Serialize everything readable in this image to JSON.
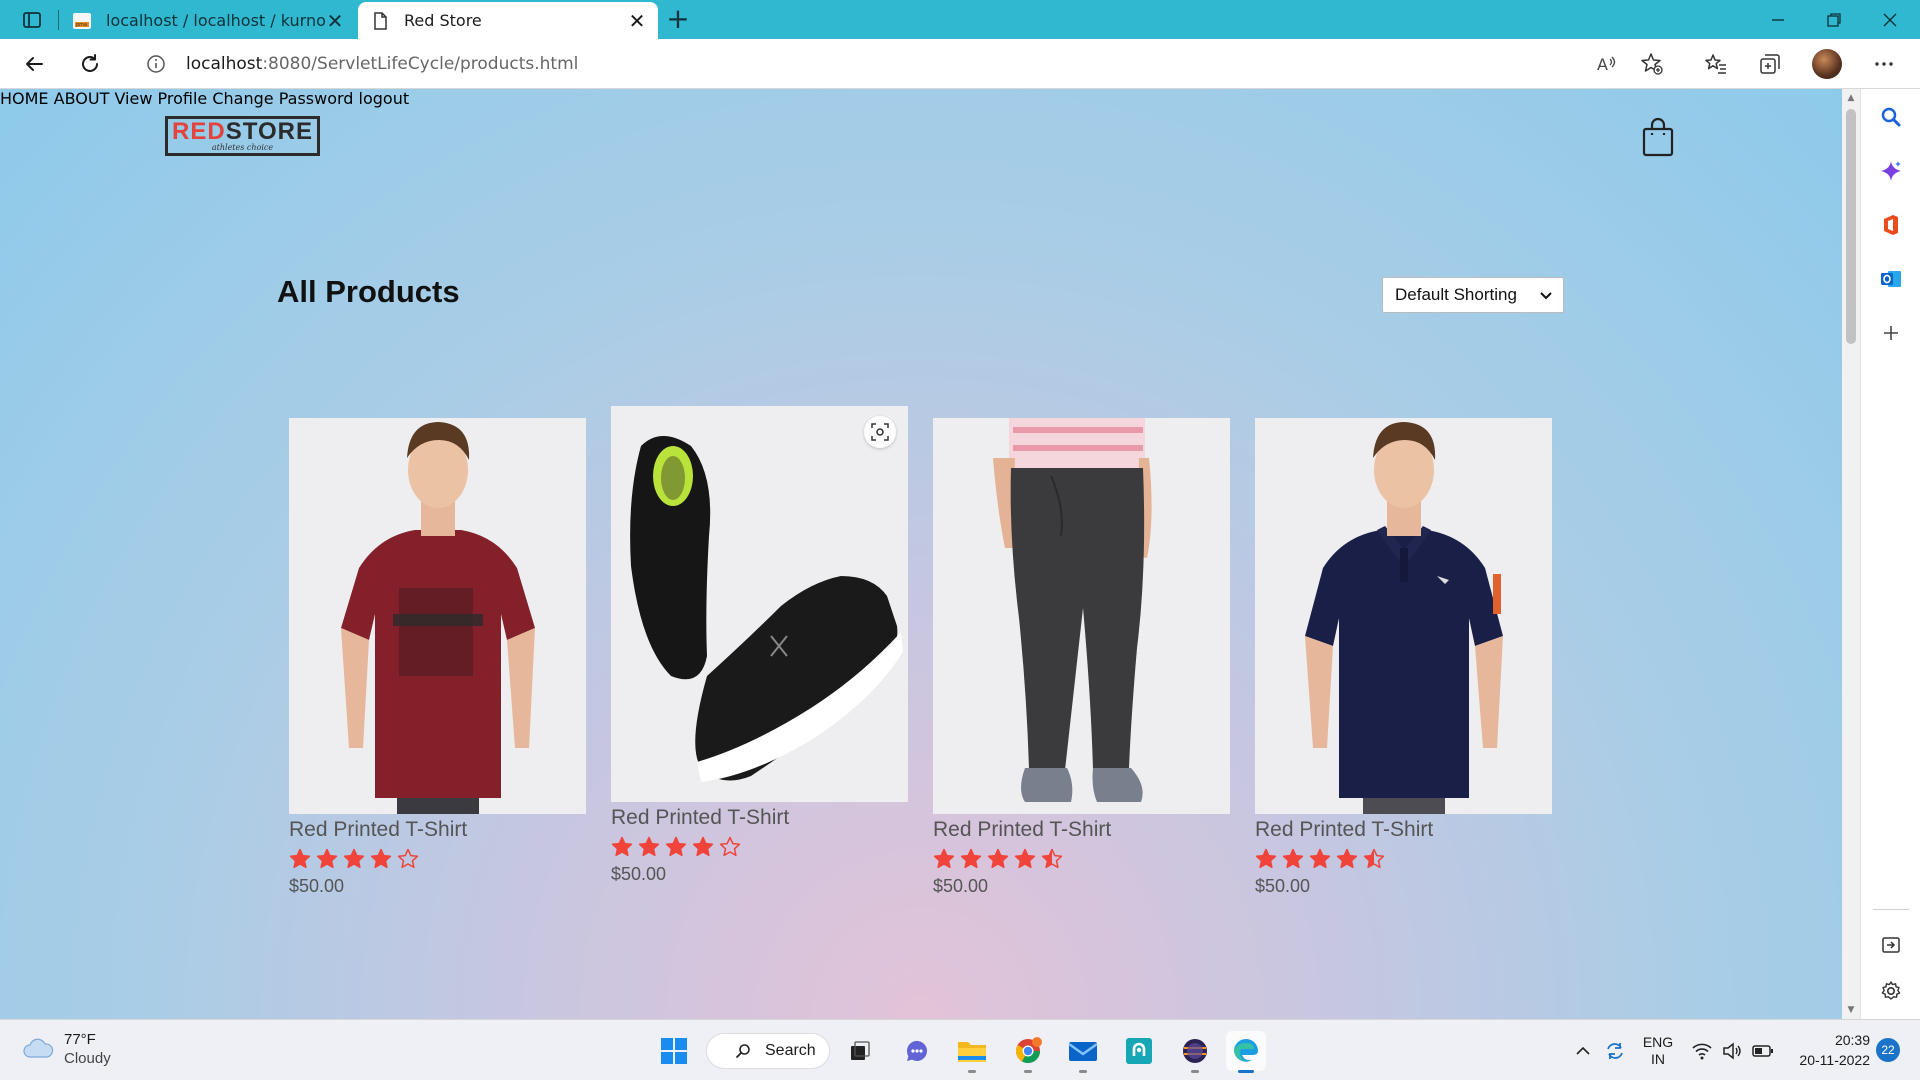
{
  "browser": {
    "tabs": [
      {
        "title": "localhost / localhost / kurnool / p",
        "active": false
      },
      {
        "title": "Red Store",
        "active": true
      }
    ],
    "address": {
      "host": "localhost",
      "path": ":8080/ServletLifeCycle/products.html"
    }
  },
  "site": {
    "logo": {
      "brand_red": "RED",
      "brand_dark": "STORE",
      "tagline": "athletes choice"
    },
    "nav": [
      {
        "label": "HOME"
      },
      {
        "label": "ABOUT"
      },
      {
        "label": "View Profile"
      },
      {
        "label": "Change Password"
      },
      {
        "label": "logout"
      }
    ],
    "heading": "All Products",
    "sort": {
      "selected": "Default Shorting"
    },
    "products": [
      {
        "name": "Red Printed T-Shirt",
        "rating": 4,
        "price": "$50.00",
        "image": "maroon-tshirt"
      },
      {
        "name": "Red Printed T-Shirt",
        "rating": 4,
        "price": "$50.00",
        "image": "black-shoes"
      },
      {
        "name": "Red Printed T-Shirt",
        "rating": 4.5,
        "price": "$50.00",
        "image": "grey-joggers"
      },
      {
        "name": "Red Printed T-Shirt",
        "rating": 4.5,
        "price": "$50.00",
        "image": "navy-polo"
      }
    ]
  },
  "taskbar": {
    "weather": {
      "temp": "77°F",
      "condition": "Cloudy"
    },
    "search_label": "Search",
    "language": {
      "line1": "ENG",
      "line2": "IN"
    },
    "clock": {
      "time": "20:39",
      "date": "20-11-2022"
    },
    "notifications": "22"
  },
  "colors": {
    "star": "#f0443b",
    "brand_red": "#e3433c",
    "titlebar": "#2fb8cf",
    "accent": "#1a73c9"
  }
}
